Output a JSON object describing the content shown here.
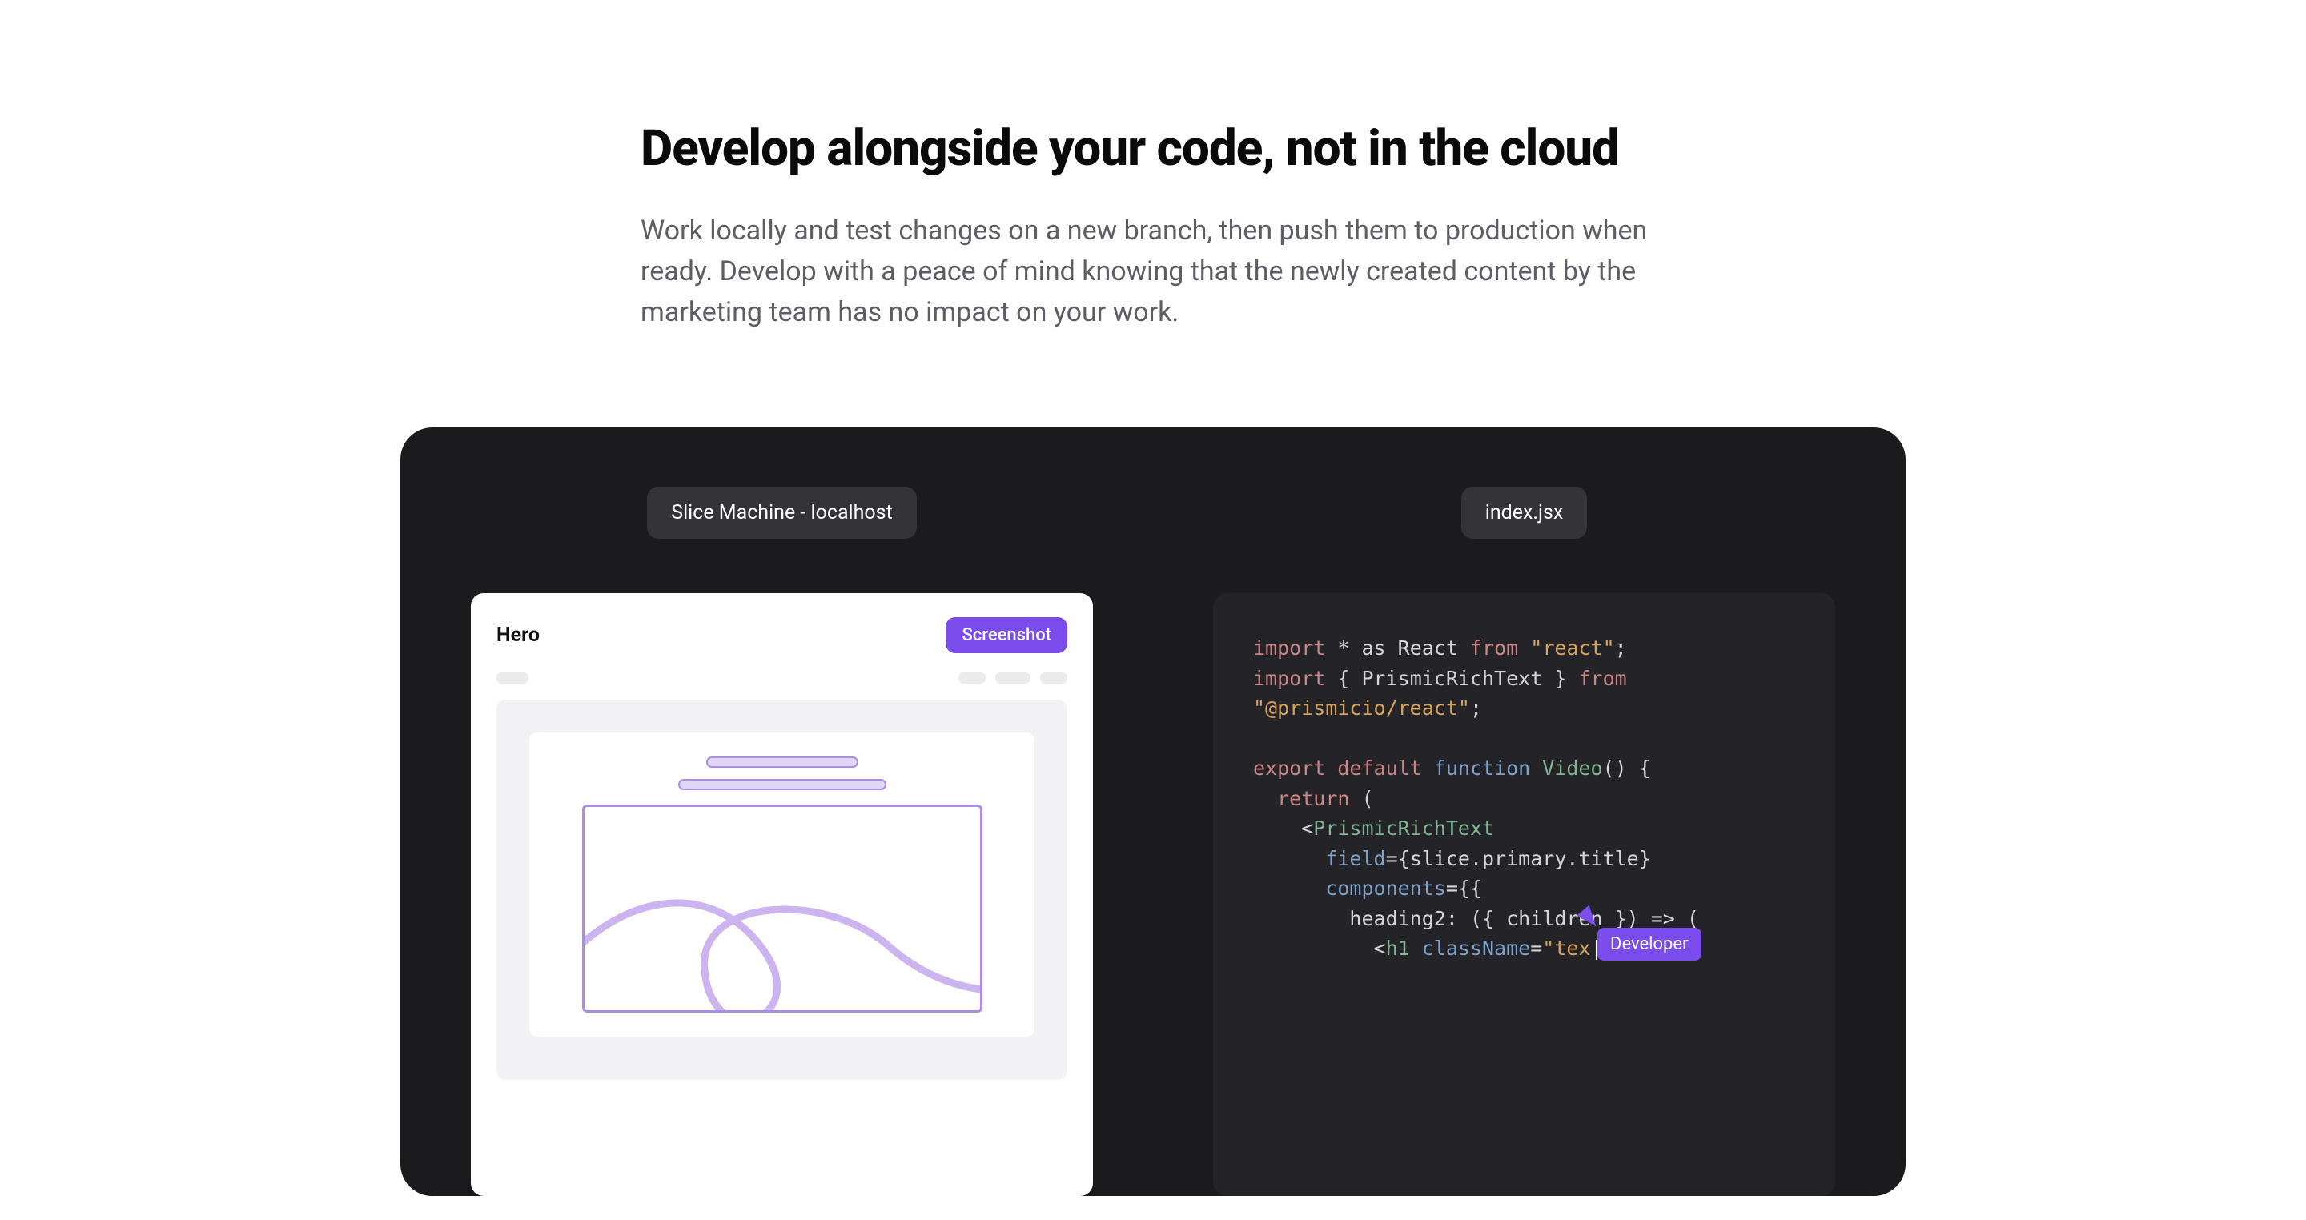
{
  "heading": "Develop alongside your code, not in the cloud",
  "subtext": "Work locally and test changes on a new branch, then push them to production when ready. Develop with a peace of mind knowing that the newly created content by the marketing team has no impact on your work.",
  "left": {
    "tab_label": "Slice Machine - localhost",
    "slice_title": "Hero",
    "screenshot_button": "Screenshot"
  },
  "right": {
    "tab_label": "index.jsx",
    "cursor_label": "Developer",
    "code": {
      "l1": {
        "import": "import",
        "star": "*",
        "as": "as",
        "react_ident": "React",
        "from": "from",
        "react_str": "\"react\"",
        "semi": ";"
      },
      "l2": {
        "import": "import",
        "lbrace": "{",
        "rich": "PrismicRichText",
        "rbrace": "}",
        "from": "from"
      },
      "l3": {
        "pkg": "\"@prismicio/react\"",
        "semi": ";"
      },
      "l4": {
        "export": "export",
        "default": "default",
        "function": "function",
        "name": "Video",
        "parens": "()",
        "brace": "{"
      },
      "l5": {
        "return": "return",
        "paren": "("
      },
      "l6": {
        "lt": "<",
        "tag": "PrismicRichText"
      },
      "l7": {
        "attr": "field",
        "eq": "=",
        "lb": "{",
        "val": "slice.primary.title",
        "rb": "}"
      },
      "l8": {
        "attr": "components",
        "eq": "=",
        "open": "{{"
      },
      "l9": {
        "key": "heading2",
        "colon": ":",
        "args": "({ children }) => ("
      },
      "l10": {
        "lt": "<",
        "tag": "h1",
        "attr": "className",
        "eq": "=",
        "val": "\"tex",
        "cursor": "|"
      }
    }
  }
}
